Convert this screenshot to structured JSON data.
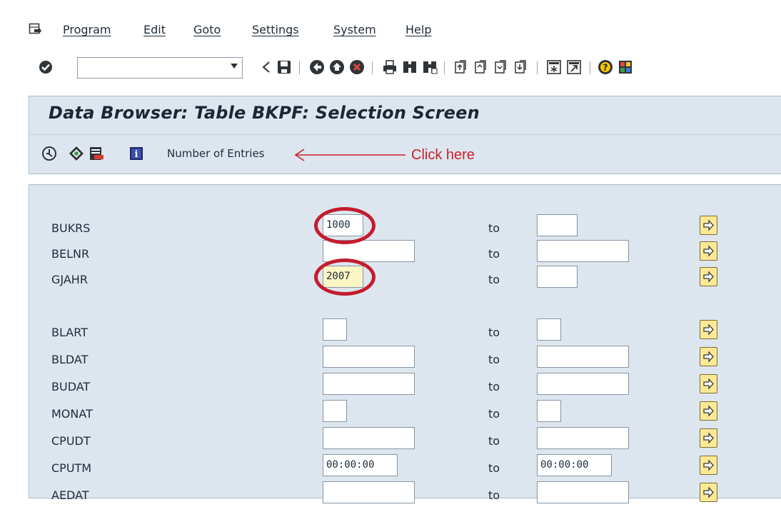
{
  "menu": {
    "items": [
      "Program",
      "Edit",
      "Goto",
      "Settings",
      "System",
      "Help"
    ]
  },
  "toolbar": {
    "command_field_value": "",
    "icons": [
      "enter-icon",
      "back-icon",
      "save-icon",
      "back-green-icon",
      "exit-icon",
      "cancel-icon",
      "print-icon",
      "find-icon",
      "find-next-icon",
      "first-page-icon",
      "previous-page-icon",
      "next-page-icon",
      "last-page-icon",
      "create-session-icon",
      "shortcut-icon",
      "help-icon",
      "customize-layout-icon"
    ]
  },
  "header": {
    "title": "Data Browser: Table BKPF: Selection Screen"
  },
  "app_toolbar": {
    "icons": [
      "execute-icon",
      "selection-options-icon",
      "delete-row-icon",
      "info-icon"
    ],
    "number_of_entries_label": "Number of Entries"
  },
  "annotation": {
    "text": "Click here",
    "color": "#c8202f"
  },
  "fields": [
    {
      "name": "BUKRS",
      "from": "1000",
      "to_label": "to",
      "to_value": ""
    },
    {
      "name": "BELNR",
      "from": "",
      "to_label": "to",
      "to_value": ""
    },
    {
      "name": "GJAHR",
      "from": "2007",
      "to_label": "to",
      "to_value": ""
    },
    {
      "name": "BLART",
      "from": "",
      "to_label": "to",
      "to_value": ""
    },
    {
      "name": "BLDAT",
      "from": "",
      "to_label": "to",
      "to_value": ""
    },
    {
      "name": "BUDAT",
      "from": "",
      "to_label": "to",
      "to_value": ""
    },
    {
      "name": "MONAT",
      "from": "",
      "to_label": "to",
      "to_value": ""
    },
    {
      "name": "CPUDT",
      "from": "",
      "to_label": "to",
      "to_value": ""
    },
    {
      "name": "CPUTM",
      "from": "00:00:00",
      "to_label": "to",
      "to_value": "00:00:00"
    },
    {
      "name": "AEDAT",
      "from": "",
      "to_label": "to",
      "to_value": ""
    }
  ]
}
